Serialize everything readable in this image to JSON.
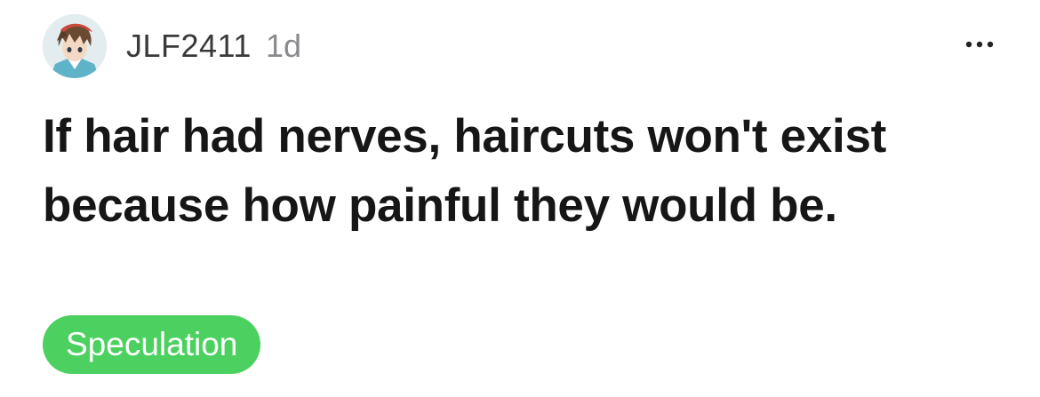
{
  "post": {
    "author": {
      "username": "JLF2411",
      "age": "1d",
      "avatar_icon": "anime-character-avatar"
    },
    "more_icon": "ellipsis-icon",
    "title": "If hair had nerves, haircuts won't exist because how painful they would be.",
    "tag": {
      "label": "Speculation",
      "color": "#4cd160"
    }
  }
}
